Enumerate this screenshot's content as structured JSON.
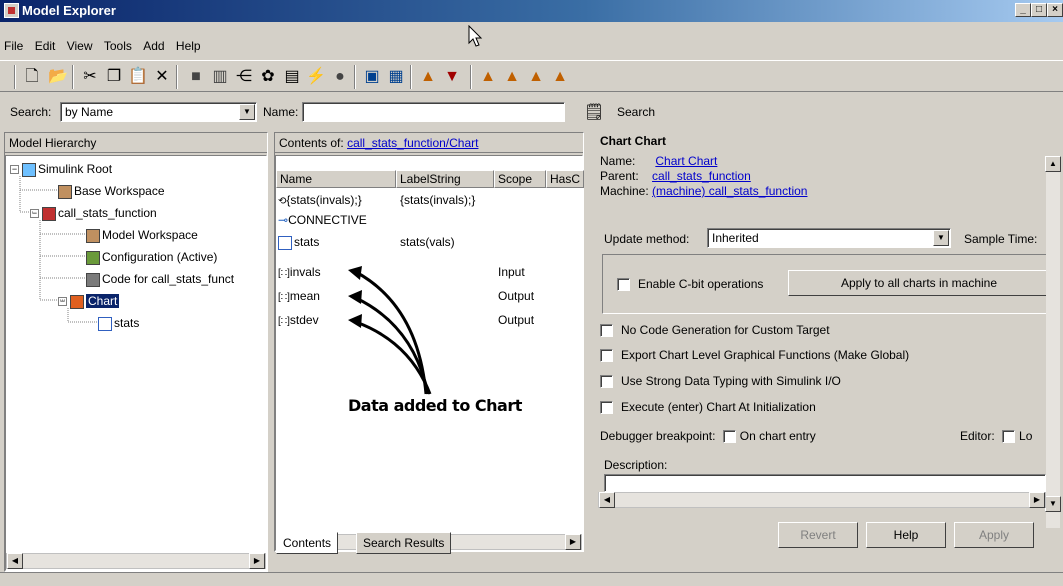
{
  "window": {
    "title": "Model Explorer",
    "min": "_",
    "max": "□",
    "close": "×"
  },
  "menu": [
    "File",
    "Edit",
    "View",
    "Tools",
    "Add",
    "Help"
  ],
  "search": {
    "label": "Search:",
    "by": "by Name",
    "name_label": "Name:",
    "name_value": "",
    "button": "Search"
  },
  "hierarchy": {
    "header": "Model Hierarchy",
    "items": [
      "Simulink Root",
      "Base Workspace",
      "call_stats_function",
      "Model Workspace",
      "Configuration (Active)",
      "Code for call_stats_funct",
      "Chart",
      "stats"
    ]
  },
  "contents": {
    "header_prefix": "Contents of:",
    "header_link": "call_stats_function/Chart",
    "columns": [
      "Name",
      "LabelString",
      "Scope",
      "HasC"
    ],
    "rows": [
      {
        "name": "{stats(invals);}",
        "label": "{stats(invals);}",
        "scope": ""
      },
      {
        "name": "CONNECTIVE",
        "label": "",
        "scope": ""
      },
      {
        "name": "stats",
        "label": "stats(vals)",
        "scope": ""
      },
      {
        "name": "invals",
        "label": "",
        "scope": "Input"
      },
      {
        "name": "mean",
        "label": "",
        "scope": "Output"
      },
      {
        "name": "stdev",
        "label": "",
        "scope": "Output"
      }
    ],
    "tabs": [
      "Contents",
      "Search Results"
    ],
    "annotation": "Data added to Chart"
  },
  "dialog": {
    "title": "Chart Chart",
    "name_label": "Name:",
    "name_value": "Chart Chart",
    "parent_label": "Parent:",
    "parent_value": "call_stats_function",
    "machine_label": "Machine:",
    "machine_value": "(machine) call_stats_function",
    "update_label": "Update method:",
    "update_value": "Inherited",
    "sample_label": "Sample Time:",
    "cbit_label": "Enable C-bit operations",
    "apply_all": "Apply to all charts in machine",
    "checks": [
      "No Code Generation for Custom Target",
      "Export Chart Level Graphical Functions (Make Global)",
      "Use Strong Data Typing with Simulink I/O",
      "Execute (enter) Chart At Initialization"
    ],
    "debugger_label": "Debugger breakpoint:",
    "debugger_cb": "On chart entry",
    "editor_label": "Editor:",
    "editor_cb": "Lo",
    "desc_label": "Description:",
    "buttons": {
      "revert": "Revert",
      "help": "Help",
      "apply": "Apply"
    }
  }
}
